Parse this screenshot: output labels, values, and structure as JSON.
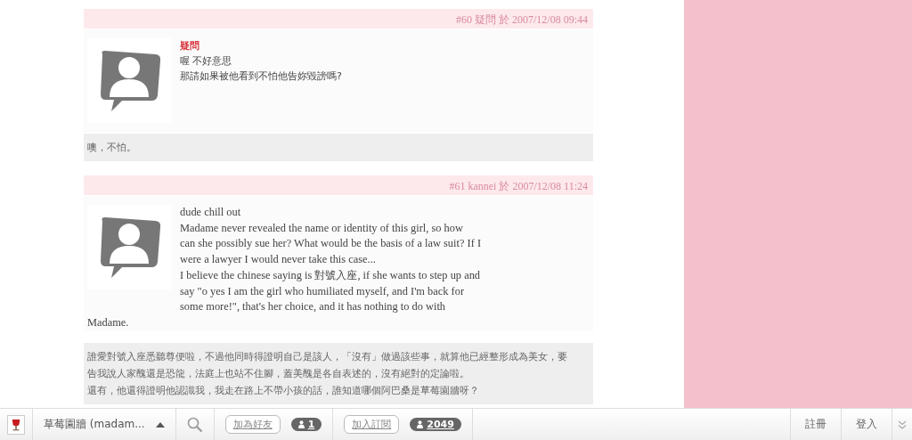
{
  "comments": [
    {
      "header": "#60 疑問 於 2007/12/08 09:44",
      "author": "疑問",
      "lines": [
        "喔 不好意思",
        "那請如果被他看到不怕他告妳毀謗嗎?"
      ],
      "serif": false,
      "reply": [
        "噢，不怕。"
      ]
    },
    {
      "header": "#61 kannei 於 2007/12/08 11:24",
      "lines": [
        "dude chill out",
        "Madame never revealed the name or identity of this girl, so how can she possibly sue her? What would be the basis of a law suit? If I were a lawyer I would never take this case...",
        "I believe the chinese saying is 對號入座, if she wants to step up and say \"o yes I am the girl who humiliated myself, and I'm back for some more!\", that's her choice, and it has nothing to do with Madame."
      ],
      "serif": true,
      "reply": [
        "誰愛對號入座悉聽尊便啦，不過他同時得證明自己是該人，「沒有」做過該些事，就算他已經整形成為美女，要告我說人家醜還是恐龍，法庭上也站不住腳，蓋美醜是各自表述的，沒有絕對的定論啦。",
        "還有，他還得證明他認識我，我走在路上不帶小孩的話，誰知道哪個阿巴桑是草莓園牆呀？"
      ]
    }
  ],
  "bottom_bar": {
    "blog_title": "草莓園牆 (madam...",
    "friend_button": "加為好友",
    "friend_count": "1",
    "subscribe_button": "加入訂閱",
    "subscriber_count": "2049",
    "register": "註冊",
    "login": "登入"
  }
}
